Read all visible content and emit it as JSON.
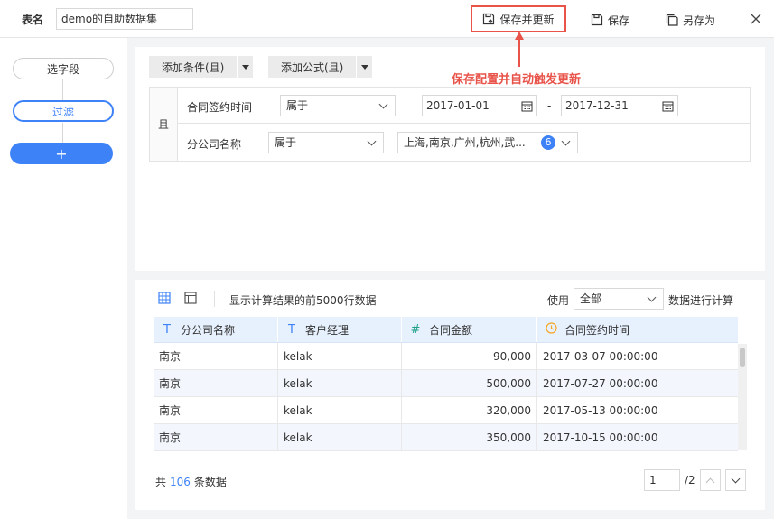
{
  "header": {
    "table_name_label": "表名",
    "table_name_value": "demo的自助数据集",
    "save_update_label": "保存并更新",
    "save_label": "保存",
    "save_as_label": "另存为"
  },
  "sidebar": {
    "steps": [
      {
        "label": "选字段"
      },
      {
        "label": "过滤"
      }
    ],
    "add_label": "+"
  },
  "conditions": {
    "add_condition_label": "添加条件(且)",
    "add_formula_label": "添加公式(且)",
    "annotation": "保存配置并自动触发更新",
    "logic_label": "且",
    "rows": [
      {
        "field": "合同签约时间",
        "operator": "属于",
        "from": "2017-01-01",
        "separator": "-",
        "to": "2017-12-31"
      },
      {
        "field": "分公司名称",
        "operator": "属于",
        "values": "上海,南京,广州,杭州,武...",
        "count": "6"
      }
    ]
  },
  "results": {
    "description": "显示计算结果的前5000行数据",
    "use_label": "使用",
    "use_value": "全部",
    "calc_label": "数据进行计算",
    "columns": [
      {
        "type_icon": "T",
        "name": "分公司名称"
      },
      {
        "type_icon": "T",
        "name": "客户经理"
      },
      {
        "type_icon": "#",
        "name": "合同金额"
      },
      {
        "type_icon": "clock-icon",
        "name": "合同签约时间"
      }
    ],
    "rows": [
      [
        "南京",
        "kelak",
        "90,000",
        "2017-03-07 00:00:00"
      ],
      [
        "南京",
        "kelak",
        "500,000",
        "2017-07-27 00:00:00"
      ],
      [
        "南京",
        "kelak",
        "320,000",
        "2017-05-13 00:00:00"
      ],
      [
        "南京",
        "kelak",
        "350,000",
        "2017-10-15 00:00:00"
      ]
    ],
    "footer": {
      "prefix": "共",
      "total": "106",
      "suffix": "条数据",
      "page_value": "1",
      "page_total": "/2"
    }
  },
  "colors": {
    "accent": "#3e82f7",
    "annotation": "#e8534a",
    "header_bg": "#e7f0fd"
  }
}
